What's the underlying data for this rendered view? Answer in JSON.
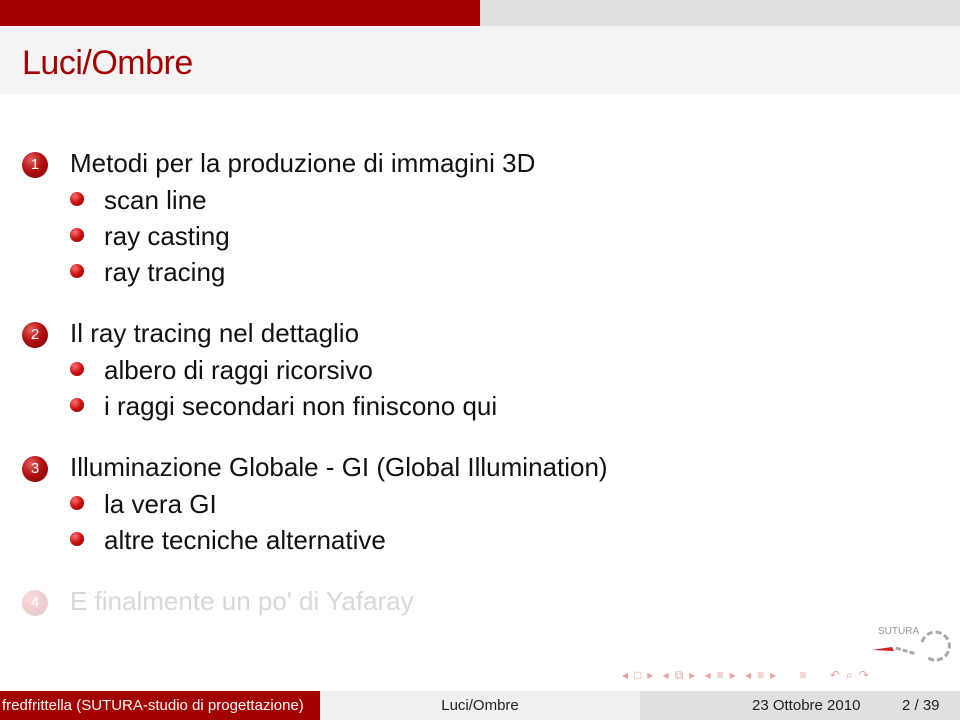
{
  "slide": {
    "title": "Luci/Ombre",
    "sections": [
      {
        "number": "1",
        "heading": "Metodi per la produzione di immagini 3D",
        "items": [
          "scan line",
          "ray casting",
          "ray tracing"
        ]
      },
      {
        "number": "2",
        "heading": "Il ray tracing nel dettaglio",
        "items": [
          "albero di raggi ricorsivo",
          "i raggi secondari non finiscono qui"
        ]
      },
      {
        "number": "3",
        "heading": "Illuminazione Globale - GI (Global Illumination)",
        "items": [
          "la vera GI",
          "altre tecniche alternative"
        ]
      },
      {
        "number": "4",
        "heading": "E finalmente un po' di Yafaray",
        "items": []
      }
    ]
  },
  "logo": {
    "text": "SUTURA"
  },
  "nav": {
    "frame_prev": "◂",
    "frame_icon": "□",
    "frame_next": "▸",
    "sub_prev": "◂",
    "sub_icon": "⧉",
    "sub_next": "▸",
    "sec_prev": "◂",
    "sec_icon": "≡",
    "sec_next": "▸",
    "ssec_prev": "◂",
    "ssec_icon": "≡",
    "ssec_next": "▸",
    "toc_icon": "≡",
    "back_icon": "↶",
    "search_icon": "⌕",
    "fwd_icon": "↷"
  },
  "footer": {
    "author": "fredfrittella  (SUTURA-studio di progettazione)",
    "short_title": "Luci/Ombre",
    "date": "23 Ottobre 2010",
    "page": "2 / 39"
  }
}
